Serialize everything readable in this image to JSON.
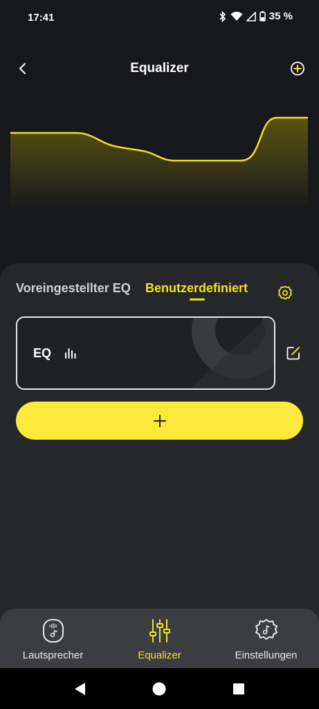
{
  "status_bar": {
    "time": "17:41",
    "battery": "35 %"
  },
  "header": {
    "title": "Equalizer"
  },
  "eq_curve": {
    "bands_db": [
      2,
      2,
      0,
      -4,
      -4,
      6
    ],
    "fill_color": "#5a5412",
    "line_color": "#f4e21d"
  },
  "tabs": {
    "preset_label": "Voreingestellter EQ",
    "custom_label": "Benutzerdefiniert",
    "active": "custom"
  },
  "eq_card": {
    "label": "EQ"
  },
  "colors": {
    "accent": "#f4e21d",
    "button": "#fde83b",
    "panel": "#25272b",
    "background": "#17181b"
  },
  "bottom_nav": {
    "items": [
      {
        "label": "Lautsprecher",
        "icon": "speaker-icon"
      },
      {
        "label": "Equalizer",
        "icon": "sliders-icon"
      },
      {
        "label": "Einstellungen",
        "icon": "settings-gear-music-icon"
      }
    ]
  },
  "system_nav": [
    "back-icon",
    "home-icon",
    "recents-icon"
  ]
}
